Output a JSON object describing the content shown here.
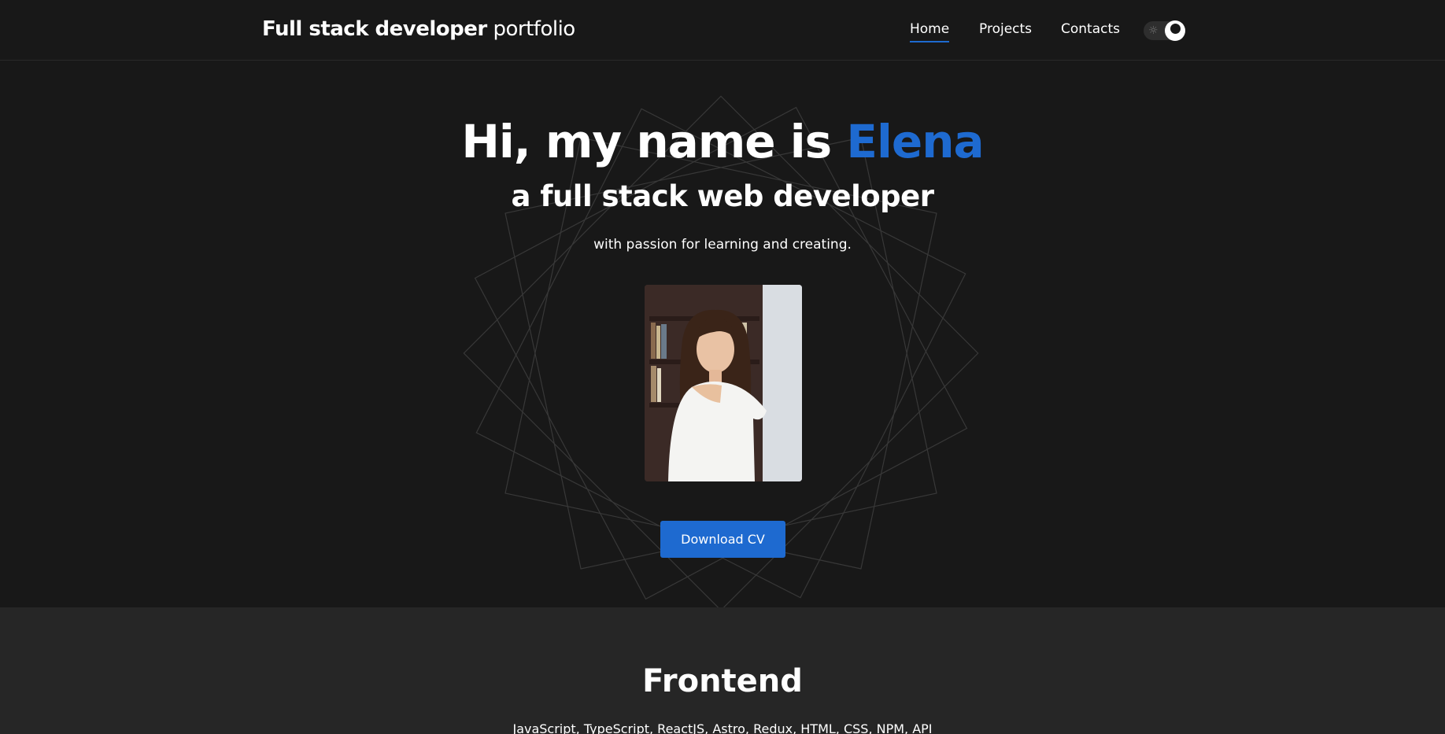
{
  "header": {
    "brand_bold": "Full stack developer",
    "brand_light": "portfolio",
    "nav": [
      {
        "label": "Home",
        "active": true
      },
      {
        "label": "Projects",
        "active": false
      },
      {
        "label": "Contacts",
        "active": false
      }
    ],
    "theme_toggle": {
      "icons": [
        "sun-icon",
        "moon-icon"
      ],
      "state": "dark"
    }
  },
  "hero": {
    "title_prefix": "Hi, my name is",
    "title_name": "Elena",
    "subtitle": "a full stack web developer",
    "tagline": "with passion for learning and creating.",
    "photo": {
      "description": "profile-photo"
    },
    "cta_label": "Download CV"
  },
  "skills": {
    "title": "Frontend",
    "list": "JavaScript, TypeScript, ReactJS, Astro, Redux, HTML, CSS, NPM, API"
  },
  "colors": {
    "background": "#181818",
    "section_background": "#262626",
    "accent": "#1e6ad0",
    "text": "#ffffff"
  }
}
